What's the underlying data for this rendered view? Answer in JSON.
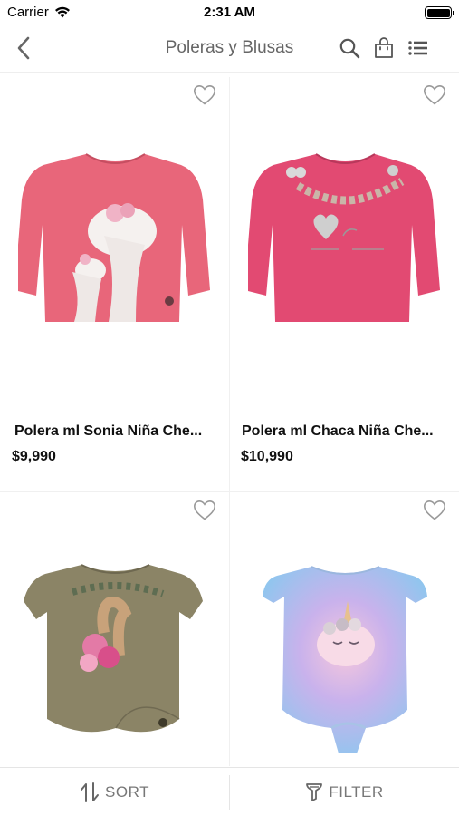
{
  "status_bar": {
    "carrier": "Carrier",
    "time": "2:31 AM"
  },
  "nav": {
    "title": "Poleras y Blusas"
  },
  "products": [
    {
      "name": "Polera ml Sonia Niña Che...",
      "price": "$9,990",
      "color": "#e8667a"
    },
    {
      "name": "Polera ml Chaca Niña Che...",
      "price": "$10,990",
      "color": "#e24a72"
    },
    {
      "name": "",
      "price": "",
      "color": "#8b8466"
    },
    {
      "name": "",
      "price": "",
      "color": "#b7d3ee"
    }
  ],
  "bottom_bar": {
    "sort_label": "SORT",
    "filter_label": "FILTER"
  }
}
